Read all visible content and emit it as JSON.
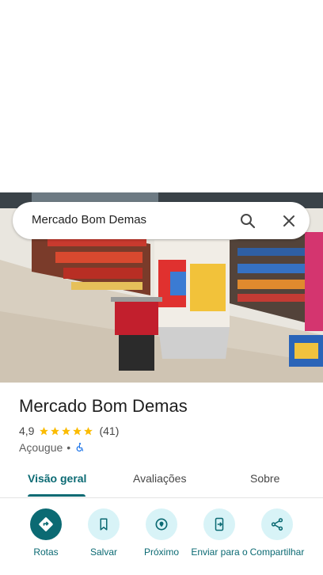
{
  "search": {
    "query": "Mercado Bom Demas"
  },
  "place": {
    "name": "Mercado Bom Demas",
    "rating": "4,9",
    "stars": 5,
    "review_count": "(41)",
    "category": "Açougue",
    "separator": "•"
  },
  "tabs": [
    {
      "label": "Visão geral"
    },
    {
      "label": "Avaliações"
    },
    {
      "label": "Sobre"
    }
  ],
  "actions": [
    {
      "label": "Rotas",
      "icon": "directions-icon"
    },
    {
      "label": "Salvar",
      "icon": "bookmark-icon"
    },
    {
      "label": "Próximo",
      "icon": "nearby-icon"
    },
    {
      "label": "Enviar para o",
      "icon": "send-to-phone-icon"
    },
    {
      "label": "Compartilhar",
      "icon": "share-icon"
    }
  ],
  "colors": {
    "accent": "#0b6a73",
    "action_bg": "#d8f3f7",
    "star": "#fbbc04"
  }
}
